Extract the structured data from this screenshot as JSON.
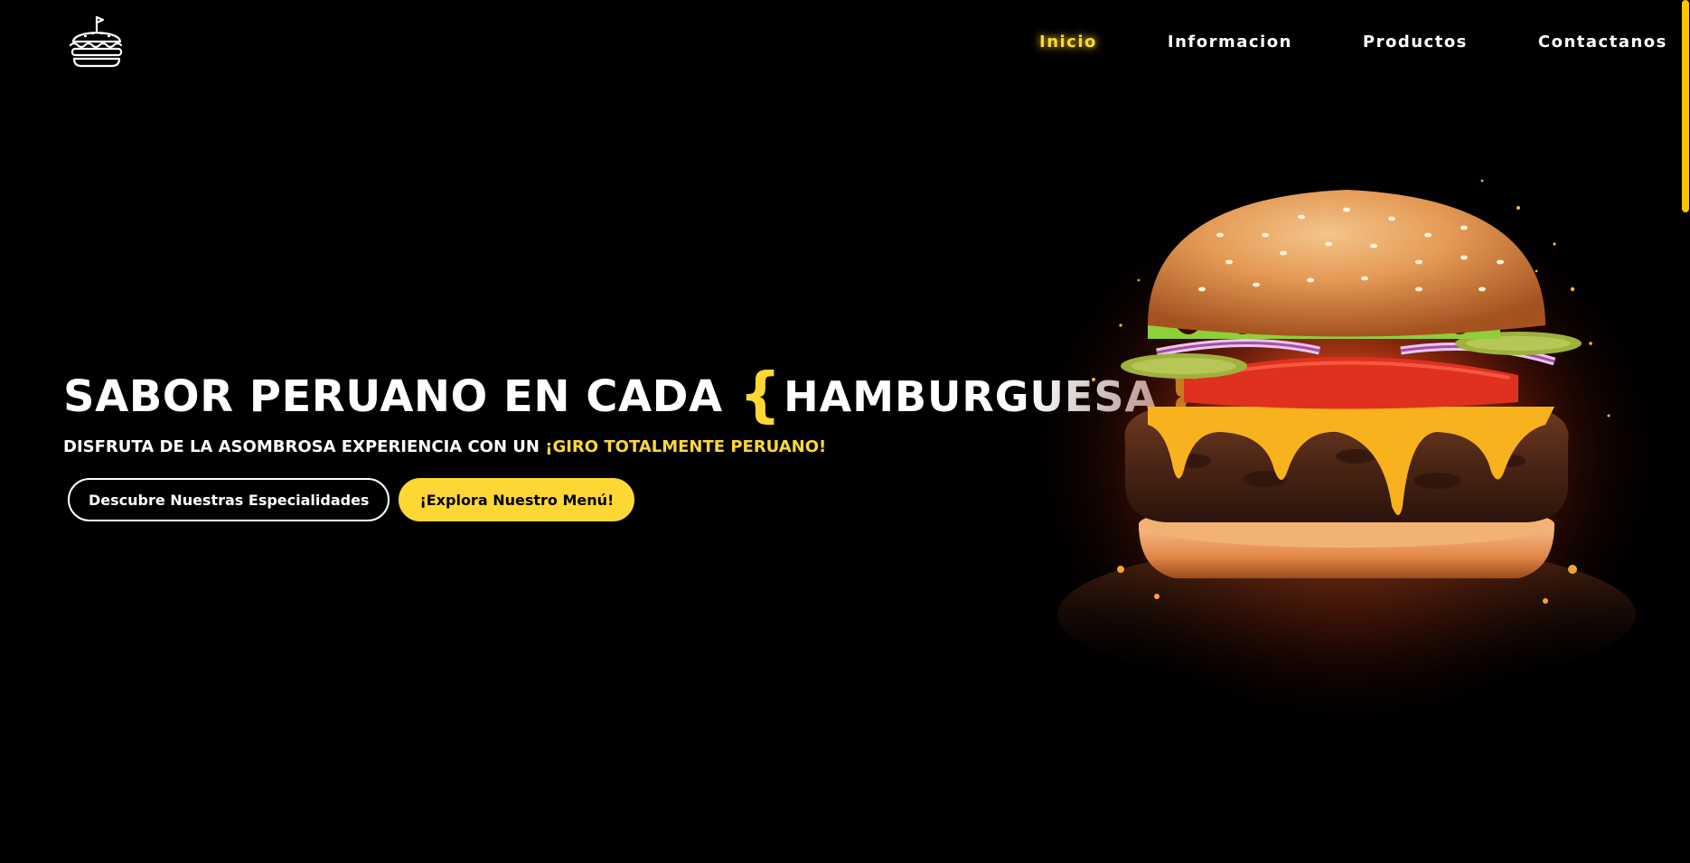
{
  "nav": {
    "items": [
      {
        "label": "Inicio",
        "active": true
      },
      {
        "label": "Informacion",
        "active": false
      },
      {
        "label": "Productos",
        "active": false
      },
      {
        "label": "Contactanos",
        "active": false
      }
    ]
  },
  "hero": {
    "title_prefix": "SABOR PERUANO EN CADA",
    "brace_open": "{",
    "title_highlight": "HAMBURGUESA",
    "brace_close": "}",
    "subtitle_main": "DISFRUTA DE LA ASOMBROSA EXPERIENCIA CON UN ",
    "subtitle_accent": "¡GIRO TOTALMENTE PERUANO!",
    "button_primary": "Descubre Nuestras Especialidades",
    "button_secondary": "¡Explora Nuestro Menú!"
  },
  "icons": {
    "logo": "burger-logo-icon"
  },
  "colors": {
    "background": "#000000",
    "accent": "#fdd835",
    "text": "#ffffff",
    "scrollbar": "#fdc400"
  }
}
